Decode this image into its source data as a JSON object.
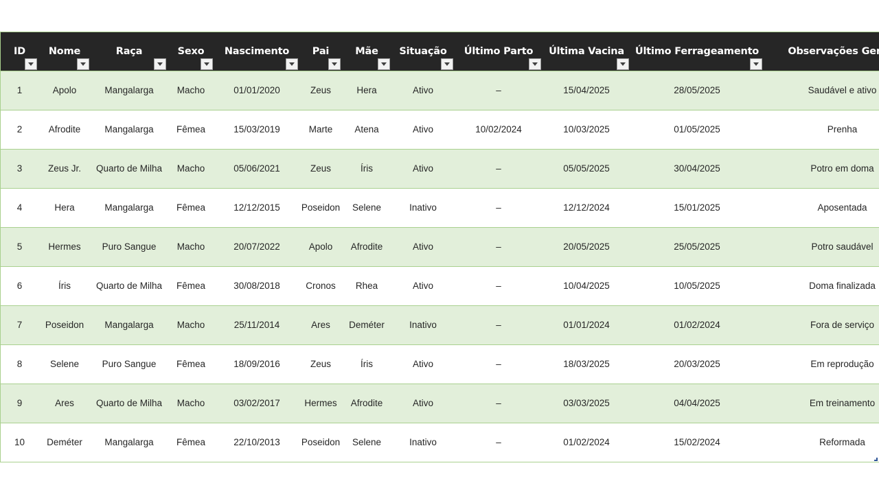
{
  "columns": [
    "ID",
    "Nome",
    "Raça",
    "Sexo",
    "Nascimento",
    "Pai",
    "Mãe",
    "Situação",
    "Último Parto",
    "Última Vacina",
    "Último Ferrageamento",
    "Observações Gerais"
  ],
  "rows": [
    [
      "1",
      "Apolo",
      "Mangalarga",
      "Macho",
      "01/01/2020",
      "Zeus",
      "Hera",
      "Ativo",
      "–",
      "15/04/2025",
      "28/05/2025",
      "Saudável e ativo"
    ],
    [
      "2",
      "Afrodite",
      "Mangalarga",
      "Fêmea",
      "15/03/2019",
      "Marte",
      "Atena",
      "Ativo",
      "10/02/2024",
      "10/03/2025",
      "01/05/2025",
      "Prenha"
    ],
    [
      "3",
      "Zeus Jr.",
      "Quarto de Milha",
      "Macho",
      "05/06/2021",
      "Zeus",
      "Íris",
      "Ativo",
      "–",
      "05/05/2025",
      "30/04/2025",
      "Potro em doma"
    ],
    [
      "4",
      "Hera",
      "Mangalarga",
      "Fêmea",
      "12/12/2015",
      "Poseidon",
      "Selene",
      "Inativo",
      "–",
      "12/12/2024",
      "15/01/2025",
      "Aposentada"
    ],
    [
      "5",
      "Hermes",
      "Puro Sangue",
      "Macho",
      "20/07/2022",
      "Apolo",
      "Afrodite",
      "Ativo",
      "–",
      "20/05/2025",
      "25/05/2025",
      "Potro saudável"
    ],
    [
      "6",
      "Íris",
      "Quarto de Milha",
      "Fêmea",
      "30/08/2018",
      "Cronos",
      "Rhea",
      "Ativo",
      "–",
      "10/04/2025",
      "10/05/2025",
      "Doma finalizada"
    ],
    [
      "7",
      "Poseidon",
      "Mangalarga",
      "Macho",
      "25/11/2014",
      "Ares",
      "Deméter",
      "Inativo",
      "–",
      "01/01/2024",
      "01/02/2024",
      "Fora de serviço"
    ],
    [
      "8",
      "Selene",
      "Puro Sangue",
      "Fêmea",
      "18/09/2016",
      "Zeus",
      "Íris",
      "Ativo",
      "–",
      "18/03/2025",
      "20/03/2025",
      "Em reprodução"
    ],
    [
      "9",
      "Ares",
      "Quarto de Milha",
      "Macho",
      "03/02/2017",
      "Hermes",
      "Afrodite",
      "Ativo",
      "–",
      "03/03/2025",
      "04/04/2025",
      "Em treinamento"
    ],
    [
      "10",
      "Deméter",
      "Mangalarga",
      "Fêmea",
      "22/10/2013",
      "Poseidon",
      "Selene",
      "Inativo",
      "–",
      "01/02/2024",
      "15/02/2024",
      "Reformada"
    ]
  ],
  "colors": {
    "header_bg": "#262626",
    "band_green": "#e2efda",
    "border_green": "#a9d08e"
  },
  "icons": {
    "filter": "chevron-down-icon"
  }
}
